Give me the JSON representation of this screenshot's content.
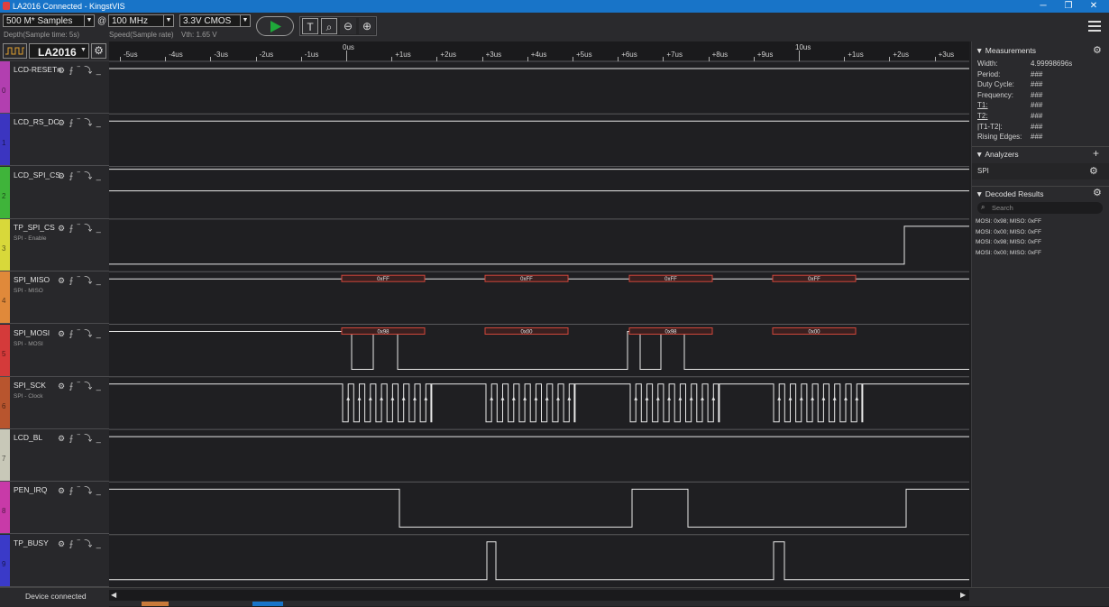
{
  "window": {
    "title": "LA2016 Connected - KingstVIS"
  },
  "toolbar": {
    "samples": "500 M* Samples",
    "at": "@",
    "rate": "100 MHz",
    "voltage": "3.3V CMOS",
    "depth_label": "Depth(Sample time: 5s)",
    "speed_label": "Speed(Sample rate)",
    "vth_label": "Vth: 1.65 V"
  },
  "device": {
    "name": "LA2016"
  },
  "ruler": {
    "ticks": [
      "-5us",
      "-4us",
      "-3us",
      "-2us",
      "-1us",
      "0us",
      "+1us",
      "+2us",
      "+3us",
      "+4us",
      "+5us",
      "+6us",
      "+7us",
      "+8us",
      "+9us",
      "10us",
      "+1us",
      "+2us",
      "+3us"
    ]
  },
  "channels": [
    {
      "num": "0",
      "name": "LCD-RESETn",
      "desc": "",
      "color": "#b23fb0"
    },
    {
      "num": "1",
      "name": "LCD_RS_DC",
      "desc": "",
      "color": "#3b35c0"
    },
    {
      "num": "2",
      "name": "LCD_SPI_CS",
      "desc": "",
      "color": "#3fb43a"
    },
    {
      "num": "3",
      "name": "TP_SPI_CS",
      "desc": "SPI - Enable",
      "color": "#d8d83a"
    },
    {
      "num": "4",
      "name": "SPI_MISO",
      "desc": "SPI - MISO",
      "color": "#e0893a"
    },
    {
      "num": "5",
      "name": "SPI_MOSI",
      "desc": "SPI - MOSI",
      "color": "#d43a3a"
    },
    {
      "num": "6",
      "name": "SPI_SCK",
      "desc": "SPI - Clock",
      "color": "#b8552e"
    },
    {
      "num": "7",
      "name": "LCD_BL",
      "desc": "",
      "color": "#c8c8b8"
    },
    {
      "num": "8",
      "name": "PEN_IRQ",
      "desc": "",
      "color": "#c83aa8"
    },
    {
      "num": "9",
      "name": "TP_BUSY",
      "desc": "",
      "color": "#3a3ac8"
    }
  ],
  "channel_icons": "⚙ ⨍ ‾ ⤵ _",
  "annotations": {
    "miso": [
      "0xFF",
      "0xFF",
      "0xFF",
      "0xFF"
    ],
    "mosi": [
      "0x98",
      "0x00",
      "0x98",
      "0x00"
    ]
  },
  "measurements": {
    "header": "Measurements",
    "rows": [
      {
        "label": "Width:",
        "value": "4.99998696s"
      },
      {
        "label": "Period:",
        "value": "###"
      },
      {
        "label": "Duty Cycle:",
        "value": "###"
      },
      {
        "label": "Frequency:",
        "value": "###"
      },
      {
        "label": "T1:",
        "value": "###"
      },
      {
        "label": "T2:",
        "value": "###"
      },
      {
        "label": "|T1-T2|:",
        "value": "###"
      },
      {
        "label": "Rising Edges:",
        "value": "###"
      }
    ]
  },
  "analyzers": {
    "header": "Analyzers",
    "item": "SPI"
  },
  "decoded": {
    "header": "Decoded Results",
    "search_placeholder": "Search",
    "rows": [
      "MOSI: 0x98;  MISO: 0xFF",
      "MOSI: 0x00;  MISO: 0xFF",
      "MOSI: 0x98;  MISO: 0xFF",
      "MOSI: 0x00;  MISO: 0xFF"
    ]
  },
  "status": {
    "text": "Device connected"
  },
  "colors": {
    "accent": "#1874c8",
    "signal": "#e8e8e8",
    "decode_box": "#d0463a",
    "run": "#1fa83a"
  }
}
